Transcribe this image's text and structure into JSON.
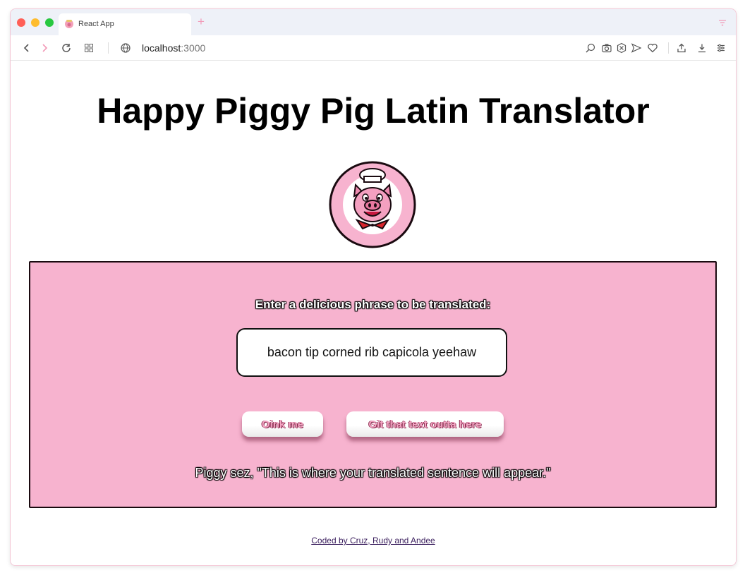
{
  "browser": {
    "tab_title": "React App",
    "new_tab_label": "+",
    "url_host": "localhost",
    "url_port": ":3000",
    "icons": [
      "back-icon",
      "forward-icon",
      "reload-icon",
      "tab-grid-icon",
      "globe-icon",
      "zoom-icon",
      "camera-icon",
      "ad-block-icon",
      "send-icon",
      "heart-icon",
      "share-icon",
      "download-icon",
      "settings-icon",
      "tab-menu-icon"
    ]
  },
  "page": {
    "title": "Happy Piggy Pig Latin Translator",
    "prompt": "Enter a delicious phrase to be translated:",
    "input_value": "bacon tip corned rib capicola yeehaw",
    "oink_button": "Oink me",
    "clear_button": "Git that text outta here",
    "result_text": "Piggy sez, \"This is where your translated sentence will appear.\"",
    "footer_link": "Coded by Cruz, Rudy and Andee"
  },
  "colors": {
    "panel_pink": "#f7b3cf",
    "button_text_pink": "#f4a6c4",
    "footer_link": "#3b1f5e"
  }
}
